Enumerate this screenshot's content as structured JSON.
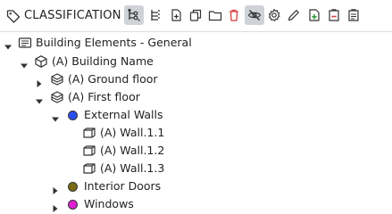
{
  "header": {
    "title": "CLASSIFICATION",
    "tag_icon": "tag-icon"
  },
  "toolbar": {
    "buttons": [
      {
        "icon": "hierarchy-tree-icon",
        "active": true
      },
      {
        "icon": "list-tree-icon",
        "active": false
      },
      {
        "icon": "add-item-icon",
        "active": false
      },
      {
        "icon": "copy-icon",
        "active": false
      },
      {
        "icon": "folder-icon",
        "active": false
      },
      {
        "icon": "delete-icon",
        "active": false,
        "color": "#d93b3b"
      },
      {
        "icon": "eye-off-icon",
        "active": true
      },
      {
        "icon": "settings-icon",
        "active": false
      },
      {
        "icon": "edit-pencil-icon",
        "active": false
      },
      {
        "icon": "add-document-icon",
        "active": false,
        "color": "#2e9e3e"
      },
      {
        "icon": "remove-document-icon",
        "active": false,
        "color": "#d93b3b"
      },
      {
        "icon": "document-list-icon",
        "active": false
      }
    ]
  },
  "tree": {
    "root": {
      "label": "Building Elements - General",
      "expanded": true,
      "icon": "classification-icon"
    },
    "building": {
      "label": "(A) Building Name",
      "expanded": true,
      "icon": "building-cube-icon"
    },
    "ground_floor": {
      "label": "(A) Ground floor",
      "expanded": false,
      "icon": "floor-stack-icon"
    },
    "first_floor": {
      "label": "(A) First floor",
      "expanded": true,
      "icon": "floor-stack-icon"
    },
    "external_walls": {
      "label": "External Walls",
      "expanded": true,
      "color": "#2b4ef0"
    },
    "walls": [
      {
        "label": "(A) Wall.1.1",
        "icon": "wall-icon"
      },
      {
        "label": "(A) Wall.1.2",
        "icon": "wall-icon"
      },
      {
        "label": "(A) Wall.1.3",
        "icon": "wall-icon"
      }
    ],
    "interior_doors": {
      "label": "Interior Doors",
      "expanded": false,
      "color": "#7a6b14"
    },
    "windows": {
      "label": "Windows",
      "expanded": false,
      "color": "#e020d0"
    }
  }
}
